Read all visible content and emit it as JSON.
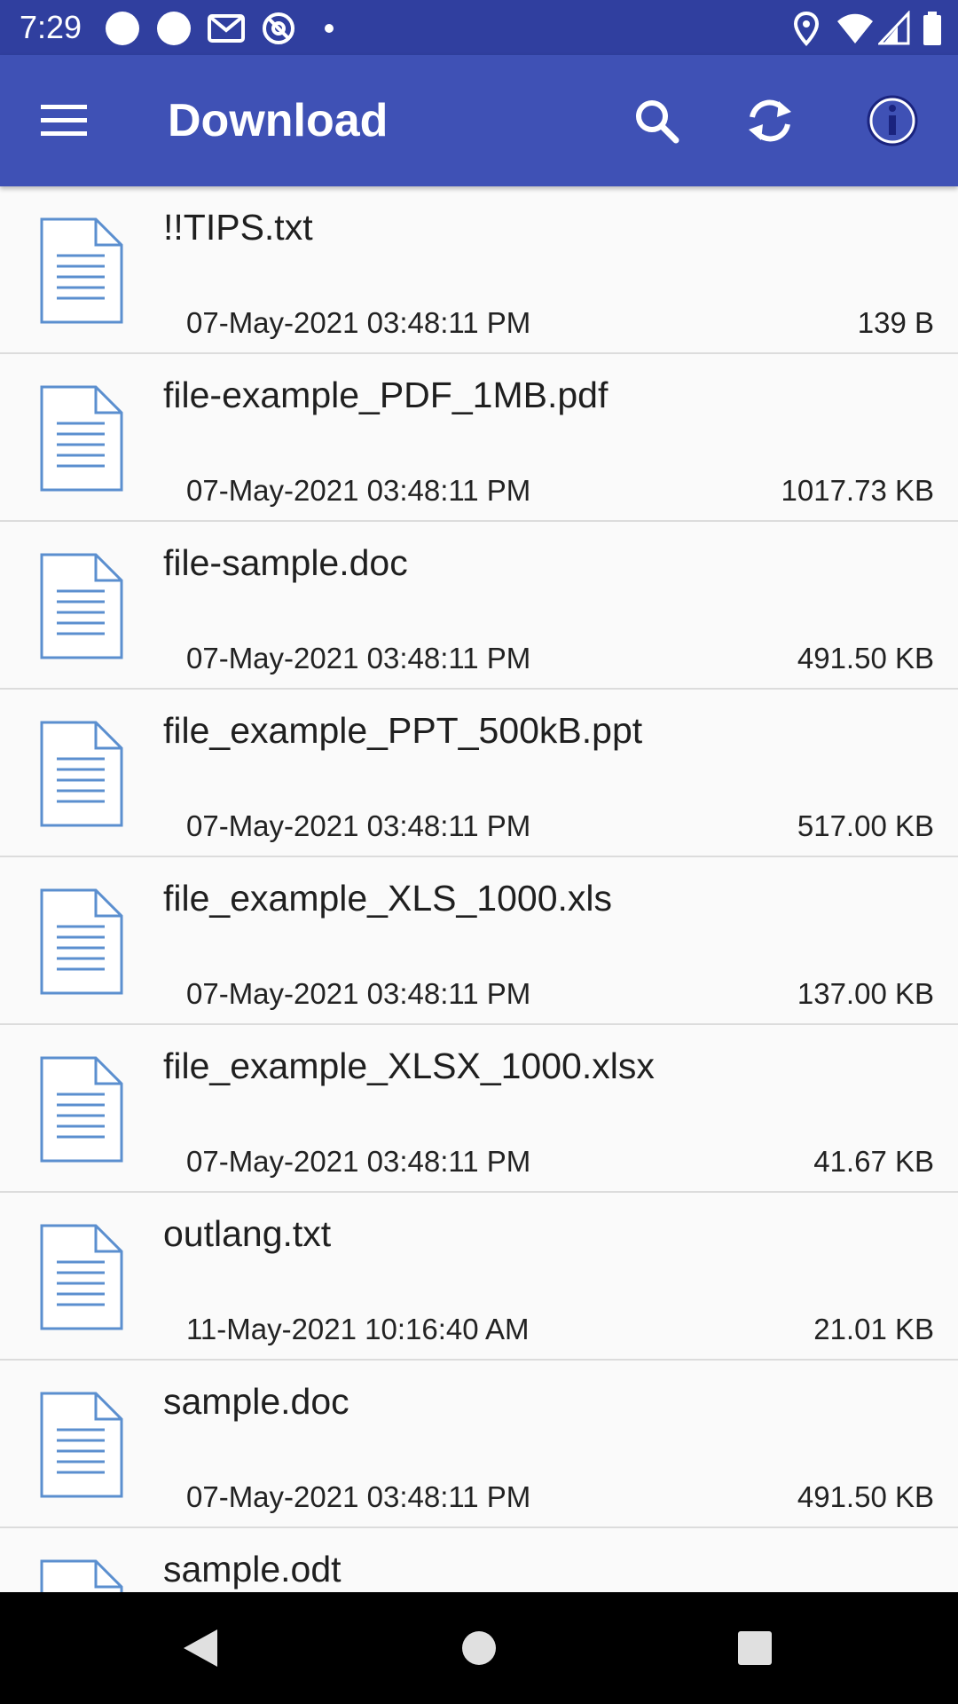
{
  "status_bar": {
    "time": "7:29",
    "left_icons": [
      "circle-notification-icon",
      "circle-notification-icon",
      "gmail-icon",
      "at-sign-icon",
      "dot-icon"
    ],
    "right_icons": [
      "location-icon",
      "wifi-icon",
      "signal-icon",
      "battery-icon"
    ]
  },
  "app_bar": {
    "title": "Download",
    "actions": [
      "menu-icon",
      "search-icon",
      "refresh-icon",
      "info-icon"
    ]
  },
  "files": [
    {
      "name": "!!TIPS.txt",
      "date": "07-May-2021 03:48:11 PM",
      "size": "139 B"
    },
    {
      "name": "file-example_PDF_1MB.pdf",
      "date": "07-May-2021 03:48:11 PM",
      "size": "1017.73 KB"
    },
    {
      "name": "file-sample.doc",
      "date": "07-May-2021 03:48:11 PM",
      "size": "491.50 KB"
    },
    {
      "name": "file_example_PPT_500kB.ppt",
      "date": "07-May-2021 03:48:11 PM",
      "size": "517.00 KB"
    },
    {
      "name": "file_example_XLS_1000.xls",
      "date": "07-May-2021 03:48:11 PM",
      "size": "137.00 KB"
    },
    {
      "name": "file_example_XLSX_1000.xlsx",
      "date": "07-May-2021 03:48:11 PM",
      "size": "41.67 KB"
    },
    {
      "name": "outlang.txt",
      "date": "11-May-2021 10:16:40 AM",
      "size": "21.01 KB"
    },
    {
      "name": "sample.doc",
      "date": "07-May-2021 03:48:11 PM",
      "size": "491.50 KB"
    },
    {
      "name": "sample.odt",
      "date": "",
      "size": ""
    }
  ],
  "nav_bar": {
    "buttons": [
      "back-icon",
      "home-icon",
      "recents-icon"
    ]
  },
  "colors": {
    "status_bar": "#303f9f",
    "app_bar": "#3f51b5",
    "file_icon": "#5b8fcf",
    "background": "#fafafa"
  }
}
